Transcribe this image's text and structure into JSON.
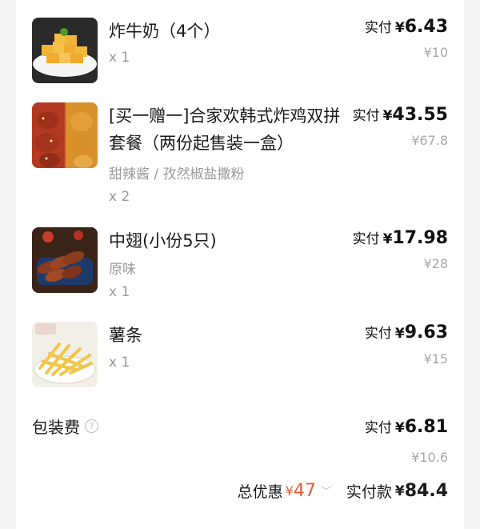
{
  "items": [
    {
      "name": "炸牛奶（4个）",
      "spec": "",
      "qty": "x 1",
      "paid_label": "实付",
      "currency": "¥",
      "paid": "6.43",
      "original": "¥10",
      "image_icon": "fried-milk-icon"
    },
    {
      "name": "[买一赠一]合家欢韩式炸鸡双拼套餐（两份起售装一盒）",
      "spec": "甜辣酱 / 孜然椒盐撒粉",
      "qty": "x 2",
      "paid_label": "实付",
      "currency": "¥",
      "paid": "43.55",
      "original": "¥67.8",
      "image_icon": "fried-chicken-icon"
    },
    {
      "name": "中翅(小份5只)",
      "spec": "原味",
      "qty": "x 1",
      "paid_label": "实付",
      "currency": "¥",
      "paid": "17.98",
      "original": "¥28",
      "image_icon": "chicken-wings-icon"
    },
    {
      "name": "薯条",
      "spec": "",
      "qty": "x 1",
      "paid_label": "实付",
      "currency": "¥",
      "paid": "9.63",
      "original": "¥15",
      "image_icon": "french-fries-icon"
    }
  ],
  "packaging": {
    "label": "包装费",
    "help_icon": "question-circle-icon",
    "help_glyph": "?",
    "paid_label": "实付",
    "currency": "¥",
    "paid": "6.81",
    "original": "¥10.6"
  },
  "summary": {
    "discount_label": "总优惠",
    "discount_currency": "¥",
    "discount": "47",
    "chevron_glyph": "﹀",
    "pay_label": "实付款",
    "pay_currency": "¥",
    "pay": "84.4",
    "accent_color": "#e65a3a"
  }
}
